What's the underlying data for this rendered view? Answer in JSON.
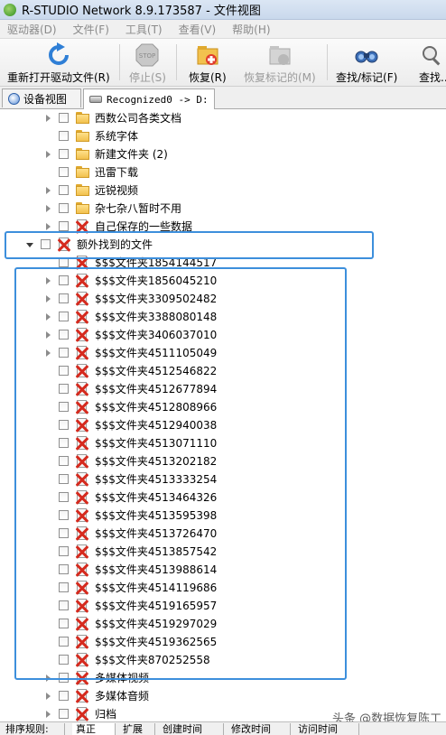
{
  "window": {
    "title": "R-STUDIO Network 8.9.173587 - 文件视图"
  },
  "menu": [
    {
      "label": "驱动器(D)"
    },
    {
      "label": "文件(F)"
    },
    {
      "label": "工具(T)"
    },
    {
      "label": "查看(V)"
    },
    {
      "label": "帮助(H)"
    }
  ],
  "toolbar": {
    "reopen": "重新打开驱动文件(R)",
    "stop": "停止(S)",
    "recover": "恢复(R)",
    "recover_marked": "恢复标记的(M)",
    "find_mark": "查找/标记(F)",
    "find_more": "查找..."
  },
  "tabs": {
    "device_view": "设备视图",
    "recognized": "Recognized0 -> D:"
  },
  "tree": {
    "top_items": [
      {
        "label": "西数公司各类文档",
        "icon": "folder-icon",
        "expandable": true
      },
      {
        "label": "系统字体",
        "icon": "folder-icon",
        "expandable": false
      },
      {
        "label": "新建文件夹 (2)",
        "icon": "folder-icon",
        "expandable": true
      },
      {
        "label": "迅雷下载",
        "icon": "folder-icon",
        "expandable": false
      },
      {
        "label": "远锐视频",
        "icon": "folder-icon",
        "expandable": true
      },
      {
        "label": "杂七杂八暂时不用",
        "icon": "folder-icon",
        "expandable": true
      },
      {
        "label": "自己保存的一些数据",
        "icon": "deleted-folder-icon",
        "expandable": true
      }
    ],
    "extra_found": {
      "label": "额外找到的文件",
      "icon": "deleted-folder-icon",
      "expanded": true
    },
    "found_items": [
      {
        "label": "$$$文件夹1854144517",
        "expandable": false
      },
      {
        "label": "$$$文件夹1856045210",
        "expandable": true
      },
      {
        "label": "$$$文件夹3309502482",
        "expandable": true
      },
      {
        "label": "$$$文件夹3388080148",
        "expandable": true
      },
      {
        "label": "$$$文件夹3406037010",
        "expandable": true
      },
      {
        "label": "$$$文件夹4511105049",
        "expandable": true
      },
      {
        "label": "$$$文件夹4512546822",
        "expandable": false
      },
      {
        "label": "$$$文件夹4512677894",
        "expandable": false
      },
      {
        "label": "$$$文件夹4512808966",
        "expandable": false
      },
      {
        "label": "$$$文件夹4512940038",
        "expandable": false
      },
      {
        "label": "$$$文件夹4513071110",
        "expandable": false
      },
      {
        "label": "$$$文件夹4513202182",
        "expandable": false
      },
      {
        "label": "$$$文件夹4513333254",
        "expandable": false
      },
      {
        "label": "$$$文件夹4513464326",
        "expandable": false
      },
      {
        "label": "$$$文件夹4513595398",
        "expandable": false
      },
      {
        "label": "$$$文件夹4513726470",
        "expandable": false
      },
      {
        "label": "$$$文件夹4513857542",
        "expandable": false
      },
      {
        "label": "$$$文件夹4513988614",
        "expandable": false
      },
      {
        "label": "$$$文件夹4514119686",
        "expandable": false
      },
      {
        "label": "$$$文件夹4519165957",
        "expandable": false
      },
      {
        "label": "$$$文件夹4519297029",
        "expandable": false
      },
      {
        "label": "$$$文件夹4519362565",
        "expandable": false
      },
      {
        "label": "$$$文件夹870252558",
        "expandable": false
      }
    ],
    "bottom_items": [
      {
        "label": "多媒体视频",
        "expandable": true
      },
      {
        "label": "多媒体音频",
        "expandable": true
      },
      {
        "label": "归档",
        "expandable": true
      }
    ]
  },
  "bottom_tabs": [
    "排序规则:",
    "真正",
    "扩展",
    "创建时间",
    "修改时间",
    "访问时间"
  ],
  "watermark": "头条 @数据恢复陈工",
  "colors": {
    "highlight_border": "#3d8fdc",
    "deleted_mark": "#d52a1e",
    "folder": "#f2c14e"
  }
}
